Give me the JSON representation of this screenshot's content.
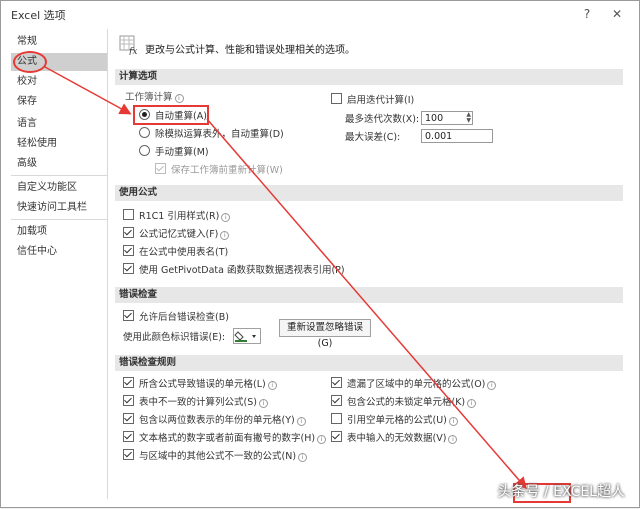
{
  "window": {
    "title": "Excel 选项",
    "help_label": "?",
    "close_label": "✕"
  },
  "sidebar": {
    "items": [
      {
        "label": "常规"
      },
      {
        "label": "公式"
      },
      {
        "label": "校对"
      },
      {
        "label": "保存"
      },
      {
        "label": "语言"
      },
      {
        "label": "轻松使用"
      },
      {
        "label": "高级"
      },
      {
        "label": "自定义功能区"
      },
      {
        "label": "快速访问工具栏"
      },
      {
        "label": "加载项"
      },
      {
        "label": "信任中心"
      }
    ],
    "selected": "公式"
  },
  "header": {
    "description": "更改与公式计算、性能和错误处理相关的选项。"
  },
  "calc": {
    "section_title": "计算选项",
    "workbook_calc_label": "工作簿计算",
    "auto": "自动重算(A)",
    "auto_except_tables": "除模拟运算表外，自动重算(D)",
    "manual": "手动重算(M)",
    "recalc_before_save": "保存工作簿前重新计算(W)",
    "iterative": "启用迭代计算(I)",
    "max_iter_label": "最多迭代次数(X):",
    "max_iter_value": "100",
    "max_change_label": "最大误差(C):",
    "max_change_value": "0.001"
  },
  "formulas": {
    "section_title": "使用公式",
    "r1c1": "R1C1 引用样式(R)",
    "autocomplete": "公式记忆式键入(F)",
    "table_names": "在公式中使用表名(T)",
    "getpivot": "使用 GetPivotData 函数获取数据透视表引用(P)"
  },
  "errorcheck": {
    "section_title": "错误检查",
    "enable_bg": "允许后台错误检查(B)",
    "color_label": "使用此颜色标识错误(E):",
    "reset_button": "重新设置忽略错误(G)"
  },
  "rules": {
    "section_title": "错误检查规则",
    "left": [
      {
        "label": "所含公式导致错误的单元格(L)",
        "checked": true
      },
      {
        "label": "表中不一致的计算列公式(S)",
        "checked": true
      },
      {
        "label": "包含以两位数表示的年份的单元格(Y)",
        "checked": true
      },
      {
        "label": "文本格式的数字或者前面有撇号的数字(H)",
        "checked": true
      },
      {
        "label": "与区域中的其他公式不一致的公式(N)",
        "checked": true
      }
    ],
    "right": [
      {
        "label": "遗漏了区域中的单元格的公式(O)",
        "checked": true
      },
      {
        "label": "包含公式的未锁定单元格(K)",
        "checked": true
      },
      {
        "label": "引用空单元格的公式(U)",
        "checked": false
      },
      {
        "label": "表中输入的无效数据(V)",
        "checked": true
      }
    ]
  },
  "watermark": "头条号 / EXCEL超人",
  "colors": {
    "accent_red": "#e53935",
    "section_bg": "#e7e7e7",
    "selected_bg": "#cfcfcf"
  }
}
